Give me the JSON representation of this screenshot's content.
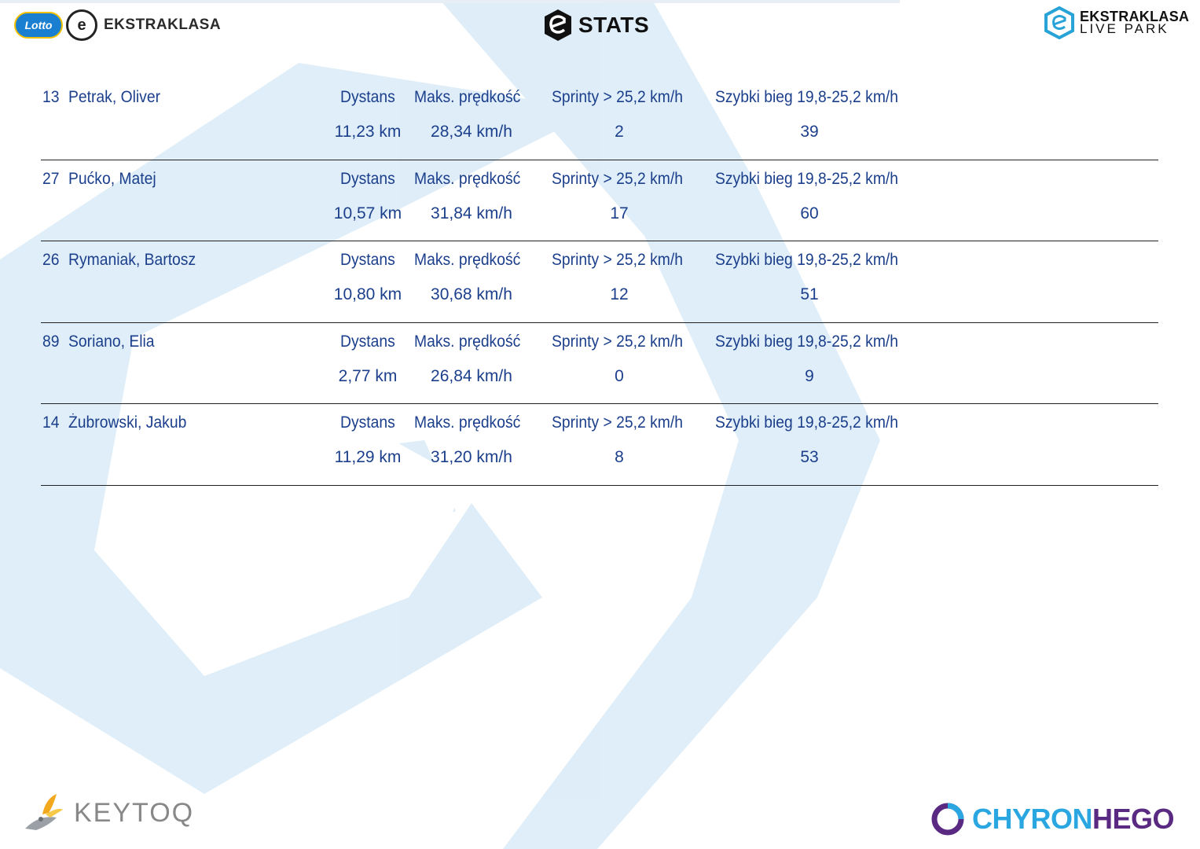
{
  "header": {
    "left_logo_lotto": "Lotto",
    "left_logo_text": "EKSTRAKLASA",
    "center_logo_text": "STATS",
    "right_logo_line1": "EKSTRAKLASA",
    "right_logo_line2": "LIVE PARK"
  },
  "labels": {
    "distance": "Dystans",
    "max_speed": "Maks. prędkość",
    "sprints": "Sprinty > 25,2 km/h",
    "fast_run": "Szybki bieg 19,8-25,2 km/h"
  },
  "players": [
    {
      "number": "13",
      "name": "Petrak, Oliver",
      "distance": "11,23 km",
      "max_speed": "28,34 km/h",
      "sprints": "2",
      "fast_run": "39"
    },
    {
      "number": "27",
      "name": "Pućko, Matej",
      "distance": "10,57 km",
      "max_speed": "31,84 km/h",
      "sprints": "17",
      "fast_run": "60"
    },
    {
      "number": "26",
      "name": "Rymaniak, Bartosz",
      "distance": "10,80 km",
      "max_speed": "30,68 km/h",
      "sprints": "12",
      "fast_run": "51"
    },
    {
      "number": "89",
      "name": "Soriano, Elia",
      "distance": "2,77 km",
      "max_speed": "26,84 km/h",
      "sprints": "0",
      "fast_run": "9"
    },
    {
      "number": "14",
      "name": "Żubrowski, Jakub",
      "distance": "11,29 km",
      "max_speed": "31,20 km/h",
      "sprints": "8",
      "fast_run": "53"
    }
  ],
  "footer": {
    "left_brand": "KEYTOQ",
    "right_brand_part1": "CHYRON",
    "right_brand_part2": "HEGO"
  },
  "colors": {
    "text_blue": "#1c3f8c",
    "watermark_blue": "#d6e9f6",
    "chyron_blue": "#2aa6e0",
    "chyron_purple": "#5a2a82"
  }
}
